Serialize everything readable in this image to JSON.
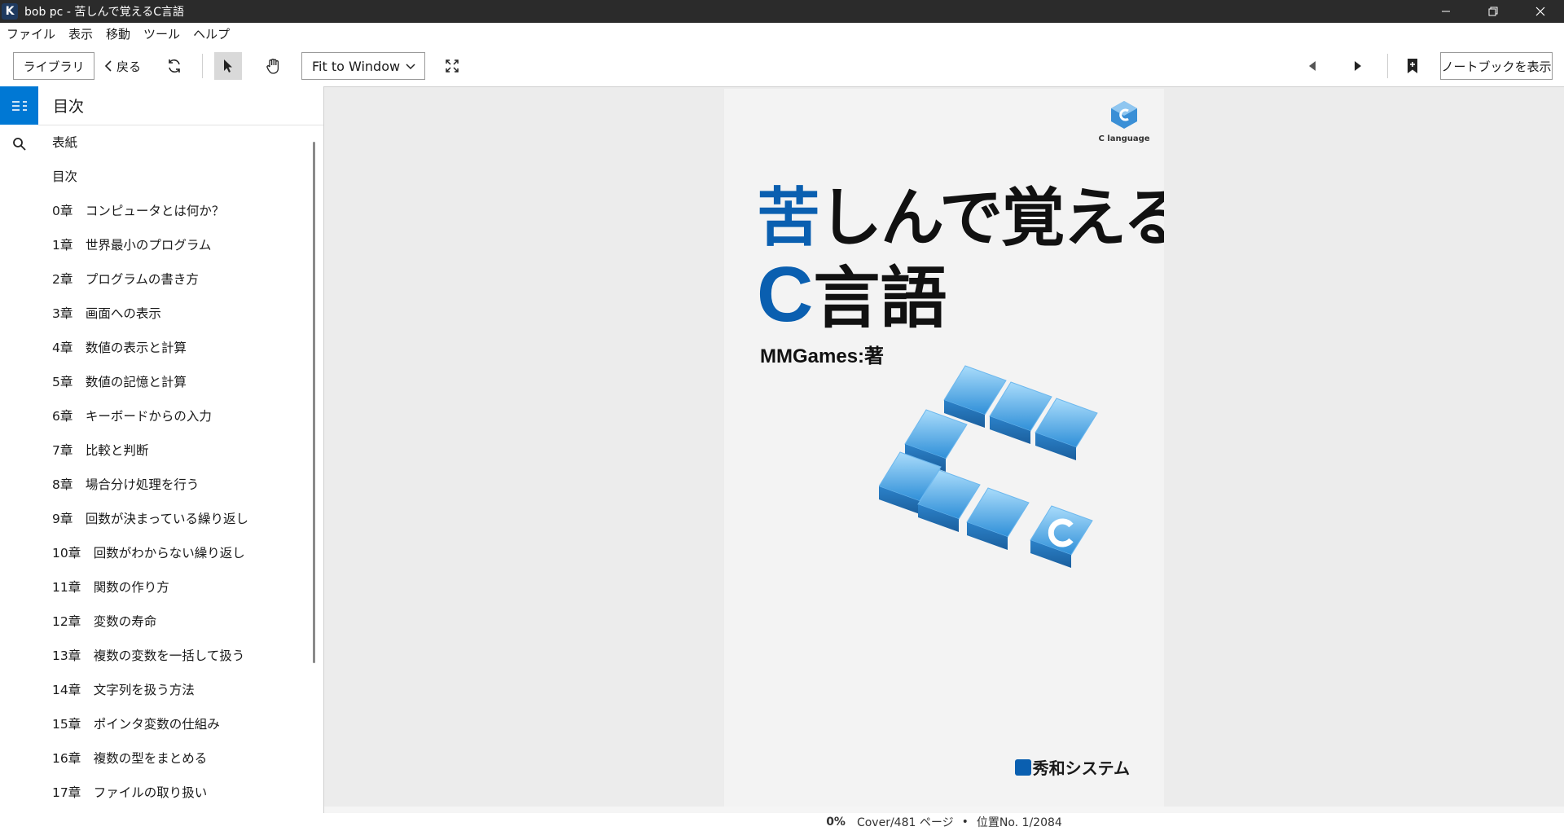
{
  "window": {
    "title": "bob pc - 苦しんで覚えるC言語",
    "app_icon_letter": "K"
  },
  "menu": [
    "ファイル",
    "表示",
    "移動",
    "ツール",
    "ヘルプ"
  ],
  "toolbar": {
    "library_label": "ライブラリ",
    "back_label": "戻る",
    "zoom_value": "Fit to Window",
    "notebook_label": "ノートブックを表示"
  },
  "toc": {
    "header": "目次",
    "items": [
      "表紙",
      "目次",
      "0章　コンピュータとは何か？",
      "1章　世界最小のプログラム",
      "2章　プログラムの書き方",
      "3章　画面への表示",
      "4章　数値の表示と計算",
      "5章　数値の記憶と計算",
      "6章　キーボードからの入力",
      "7章　比較と判断",
      "8章　場合分け処理を行う",
      "9章　回数が決まっている繰り返し",
      "10章　回数がわからない繰り返し",
      "11章　関数の作り方",
      "12章　変数の寿命",
      "13章　複数の変数を一括して扱う",
      "14章　文字列を扱う方法",
      "15章　ポインタ変数の仕組み",
      "16章　複数の型をまとめる",
      "17章　ファイルの取り扱い"
    ]
  },
  "cover": {
    "logo_text": "C language",
    "title_accent": "苦",
    "title_rest": "しんで覚える",
    "title_c": "C",
    "title_lang": "言語",
    "author": "MMGames:著",
    "publisher": "秀和システム"
  },
  "status": {
    "percent": "0%",
    "page": "Cover/481 ページ",
    "position": "位置No. 1/2084"
  },
  "colors": {
    "accent": "#0078d4",
    "cover_blue": "#0a5fb0",
    "titlebar": "#2b2b2b"
  }
}
